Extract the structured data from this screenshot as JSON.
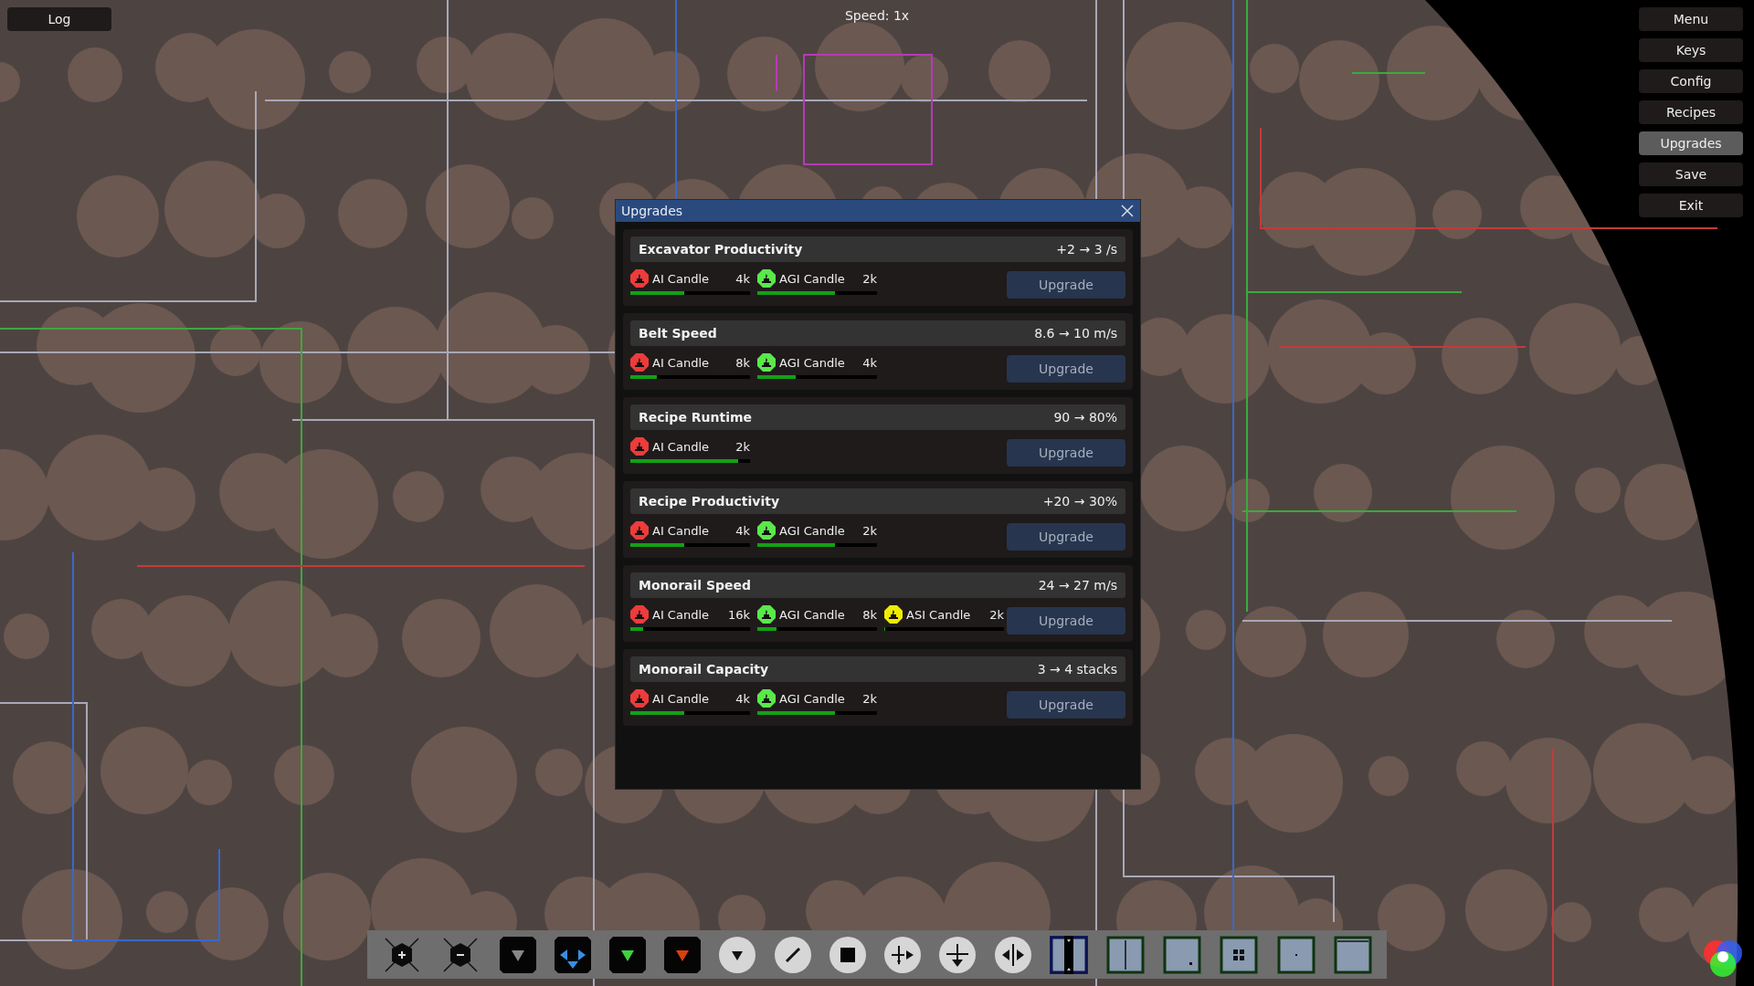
{
  "log_button": "Log",
  "speed": "Speed: 1x",
  "menu": [
    {
      "label": "Menu",
      "selected": false
    },
    {
      "label": "Keys",
      "selected": false
    },
    {
      "label": "Config",
      "selected": false
    },
    {
      "label": "Recipes",
      "selected": false
    },
    {
      "label": "Upgrades",
      "selected": true
    },
    {
      "label": "Save",
      "selected": false
    },
    {
      "label": "Exit",
      "selected": false
    }
  ],
  "dialog": {
    "title": "Upgrades",
    "upgrades": [
      {
        "title": "Excavator Productivity",
        "change": "+2 → 3 /s",
        "button": "Upgrade",
        "costs": [
          {
            "name": "AI Candle",
            "amount": "4k",
            "color": "#ee3b3b",
            "level": 0.45
          },
          {
            "name": "AGI Candle",
            "amount": "2k",
            "color": "#5ae84a",
            "level": 0.65
          }
        ]
      },
      {
        "title": "Belt Speed",
        "change": "8.6 → 10 m/s",
        "button": "Upgrade",
        "costs": [
          {
            "name": "AI Candle",
            "amount": "8k",
            "color": "#ee3b3b",
            "level": 0.22
          },
          {
            "name": "AGI Candle",
            "amount": "4k",
            "color": "#5ae84a",
            "level": 0.32
          }
        ]
      },
      {
        "title": "Recipe Runtime",
        "change": "90 → 80%",
        "button": "Upgrade",
        "costs": [
          {
            "name": "AI Candle",
            "amount": "2k",
            "color": "#ee3b3b",
            "level": 0.9
          }
        ]
      },
      {
        "title": "Recipe Productivity",
        "change": "+20 → 30%",
        "button": "Upgrade",
        "costs": [
          {
            "name": "AI Candle",
            "amount": "4k",
            "color": "#ee3b3b",
            "level": 0.45
          },
          {
            "name": "AGI Candle",
            "amount": "2k",
            "color": "#5ae84a",
            "level": 0.65
          }
        ]
      },
      {
        "title": "Monorail Speed",
        "change": "24 → 27 m/s",
        "button": "Upgrade",
        "costs": [
          {
            "name": "AI Candle",
            "amount": "16k",
            "color": "#ee3b3b",
            "level": 0.11
          },
          {
            "name": "AGI Candle",
            "amount": "8k",
            "color": "#5ae84a",
            "level": 0.16
          },
          {
            "name": "ASI Candle",
            "amount": "2k",
            "color": "#f0ec00",
            "level": 0.01
          }
        ]
      },
      {
        "title": "Monorail Capacity",
        "change": "3 → 4 stacks",
        "button": "Upgrade",
        "costs": [
          {
            "name": "AI Candle",
            "amount": "4k",
            "color": "#ee3b3b",
            "level": 0.45
          },
          {
            "name": "AGI Candle",
            "amount": "2k",
            "color": "#5ae84a",
            "level": 0.65
          }
        ]
      }
    ]
  },
  "tools": [
    {
      "kind": "hex-plus",
      "selected": false
    },
    {
      "kind": "hex-minus",
      "selected": false
    },
    {
      "kind": "tile-grey",
      "selected": false
    },
    {
      "kind": "tile-blue",
      "selected": false
    },
    {
      "kind": "tile-green",
      "selected": false
    },
    {
      "kind": "tile-orange",
      "selected": false
    },
    {
      "kind": "circle-down",
      "selected": false
    },
    {
      "kind": "circle-slash",
      "selected": false
    },
    {
      "kind": "circle-square",
      "selected": false
    },
    {
      "kind": "circle-split-right",
      "selected": false
    },
    {
      "kind": "circle-split-down",
      "selected": false
    },
    {
      "kind": "circle-split-both",
      "selected": false
    },
    {
      "kind": "panel-bar",
      "selected": true
    },
    {
      "kind": "panel-split",
      "selected": false
    },
    {
      "kind": "panel-dot",
      "selected": false
    },
    {
      "kind": "panel-grid",
      "selected": false
    },
    {
      "kind": "panel-center",
      "selected": false
    },
    {
      "kind": "panel-top",
      "selected": false
    }
  ]
}
